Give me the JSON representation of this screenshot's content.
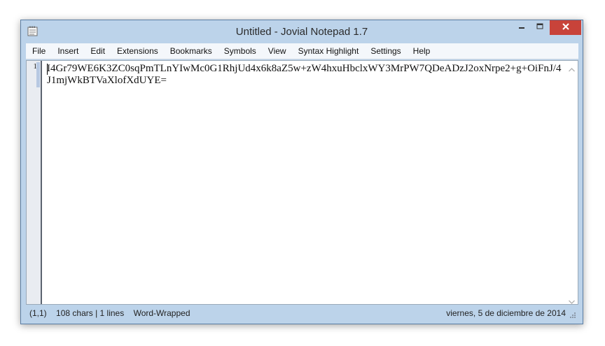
{
  "window": {
    "title": "Untitled - Jovial Notepad 1.7"
  },
  "menu": {
    "items": [
      "File",
      "Insert",
      "Edit",
      "Extensions",
      "Bookmarks",
      "Symbols",
      "View",
      "Syntax Highlight",
      "Settings",
      "Help"
    ]
  },
  "editor": {
    "line_number": "1",
    "content": "I4Gr79WE6K3ZC0sqPmTLnYIwMc0G1RhjUd4x6k8aZ5w+zW4hxuHbclxWY3MrPW7QDeADzJ2oxNrpe2+g+OiFnJ/4J1mjWkBTVaXlofXdUYE="
  },
  "status": {
    "position": "(1,1)",
    "info": "108 chars | 1 lines",
    "wrap_mode": "Word-Wrapped",
    "date": "viernes, 5 de diciembre de 2014"
  },
  "icons": {
    "app": "notepad-icon",
    "minimize": "minimize-icon",
    "maximize": "maximize-icon",
    "close": "close-icon"
  },
  "colors": {
    "frame": "#bcd3ea",
    "close_button": "#c8433a",
    "menubar": "#f4f7fb"
  }
}
